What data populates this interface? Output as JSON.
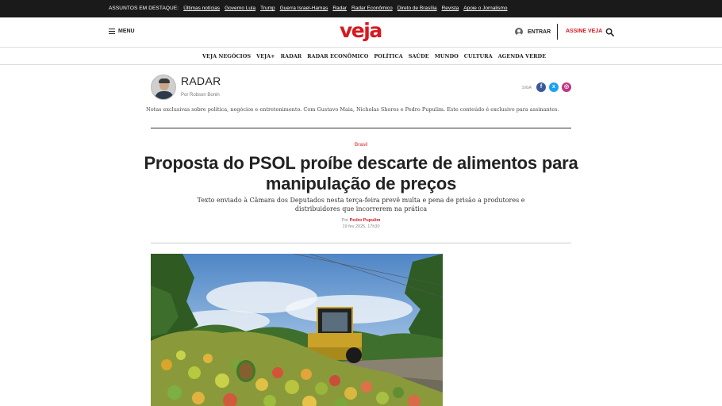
{
  "topbar": {
    "lead": "ASSUNTOS EM DESTAQUE:",
    "links": [
      "Últimas notícias",
      "Governo Lula",
      "Trump",
      "Guerra Israel-Hamas",
      "Radar",
      "Radar Econômico",
      "Direto de Brasília",
      "Revista",
      "Apoie o Jornalismo"
    ]
  },
  "header": {
    "menu_label": "MENU",
    "logo": "veja",
    "login_label": "ENTRAR",
    "subscribe_label": "ASSINE VEJA"
  },
  "nav": {
    "items": [
      "VEJA NEGÓCIOS",
      "VEJA+",
      "RADAR",
      "RADAR ECONÔMICO",
      "POLÍTICA",
      "SAÚDE",
      "MUNDO",
      "CULTURA",
      "AGENDA VERDE"
    ]
  },
  "column": {
    "title": "RADAR",
    "author": "Por Robson Bonin",
    "follow_label": "SIGA",
    "description": "Notas exclusivas sobre política, negócios e entretenimento. Com Gustavo Maia, Nicholas Shores e Pedro Pupulim. Este conteúdo é exclusivo para assinantes."
  },
  "article": {
    "section": "Brasil",
    "headline": "Proposta do PSOL proíbe descarte de alimentos para manipulação de preços",
    "subheadline": "Texto enviado à Câmara dos Deputados nesta terça-feira prevê multa e pena de prisão a produtores e distribuidores que incorrerem na prática",
    "byline_prefix": "Por",
    "author": "Pedro Pupulim",
    "date": "19 fev 2025, 17h30"
  },
  "colors": {
    "brand_red": "#d71920",
    "topbar_bg": "#1a1a1a",
    "facebook": "#3b5998",
    "twitter": "#1da1f2",
    "instagram": "#c13584"
  }
}
